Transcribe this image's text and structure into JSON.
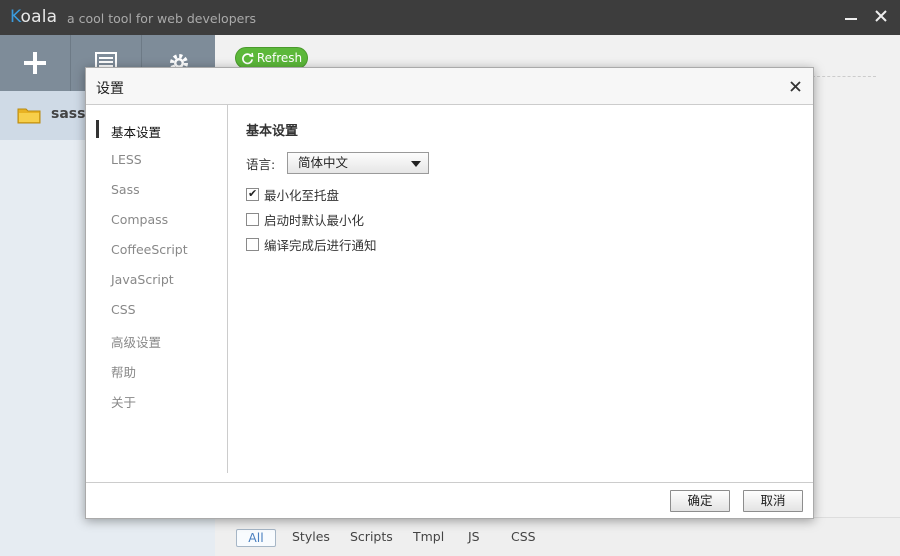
{
  "titlebar": {
    "app_name_first": "K",
    "app_name_rest": "oala",
    "tagline": "a cool tool for web developers",
    "minimize": "▬",
    "close": "✕"
  },
  "sidebar": {
    "project": {
      "name": "sass",
      "icon": "folder-icon"
    },
    "tools": [
      {
        "icon": "plus-icon"
      },
      {
        "icon": "list-icon"
      },
      {
        "icon": "gear-icon"
      }
    ]
  },
  "main": {
    "refresh_label": "Refresh",
    "filters": [
      "All",
      "Styles",
      "Scripts",
      "Tmpl",
      "JS",
      "CSS"
    ],
    "active_filter": "All"
  },
  "dialog": {
    "title": "设置",
    "close": "✕",
    "nav": [
      "基本设置",
      "LESS",
      "Sass",
      "Compass",
      "CoffeeScript",
      "JavaScript",
      "CSS",
      "高级设置",
      "帮助",
      "关于"
    ],
    "active_nav": "基本设置",
    "section_title": "基本设置",
    "language_label": "语言:",
    "language_value": "简体中文",
    "options": [
      {
        "label": "最小化至托盘",
        "checked": true
      },
      {
        "label": "启动时默认最小化",
        "checked": false
      },
      {
        "label": "编译完成后进行通知",
        "checked": false
      }
    ],
    "ok_label": "确定",
    "cancel_label": "取消"
  },
  "colors": {
    "titlebar": "#3d3d3d",
    "toolbar": "#7e8c99",
    "refresh": "#5cb83a",
    "brand_k": "#3a9bdc"
  }
}
